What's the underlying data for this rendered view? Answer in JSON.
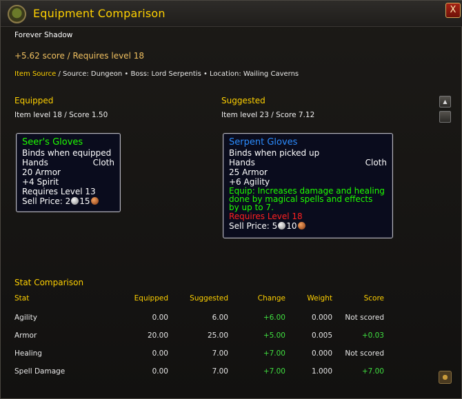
{
  "window": {
    "title": "Equipment Comparison",
    "close_label": "X"
  },
  "item": {
    "name": "Forever Shadow",
    "score_line": "+5.62 score / Requires level 18",
    "source_label": "Item Source",
    "source_text": " / Source: Dungeon • Boss: Lord Serpentis • Location: Wailing Caverns"
  },
  "equipped": {
    "heading": "Equipped",
    "summary": "Item level 18 / Score 1.50",
    "tooltip": {
      "name": "Seer's Gloves",
      "bind": "Binds when equipped",
      "slot": "Hands",
      "type": "Cloth",
      "armor": "20 Armor",
      "stat": "+4 Spirit",
      "requires": "Requires Level 13",
      "sell_label": "Sell Price: 2",
      "sell_copper": "15"
    }
  },
  "suggested": {
    "heading": "Suggested",
    "summary": "Item level 23 / Score 7.12",
    "tooltip": {
      "name": "Serpent Gloves",
      "bind": "Binds when picked up",
      "slot": "Hands",
      "type": "Cloth",
      "armor": "25 Armor",
      "stat": "+6 Agility",
      "equip_1": "Equip: Increases damage and healing",
      "equip_2": "done by magical spells and effects",
      "equip_3": "by up to 7.",
      "requires": "Requires Level 18",
      "sell_label": "Sell Price: 5",
      "sell_copper": "10"
    }
  },
  "stats": {
    "heading": "Stat Comparison",
    "columns": [
      "Stat",
      "Equipped",
      "Suggested",
      "Change",
      "Weight",
      "Score"
    ],
    "rows": [
      [
        "Agility",
        "0.00",
        "6.00",
        "+6.00",
        "0.000",
        "Not scored"
      ],
      [
        "Armor",
        "20.00",
        "25.00",
        "+5.00",
        "0.005",
        "+0.03"
      ],
      [
        "Healing",
        "0.00",
        "7.00",
        "+7.00",
        "0.000",
        "Not scored"
      ],
      [
        "Spell Damage",
        "0.00",
        "7.00",
        "+7.00",
        "1.000",
        "+7.00"
      ]
    ]
  },
  "colors": {
    "title": "#ffd100",
    "uncommon_item": "#1eff00",
    "rare_item": "#2b8cff",
    "requirement_unmet": "#ff2020",
    "positive_change": "#40e040"
  },
  "icons": {
    "portrait": "goblin-portrait-icon",
    "close": "close-icon",
    "silver": "silver-coin-icon",
    "copper": "copper-coin-icon"
  }
}
